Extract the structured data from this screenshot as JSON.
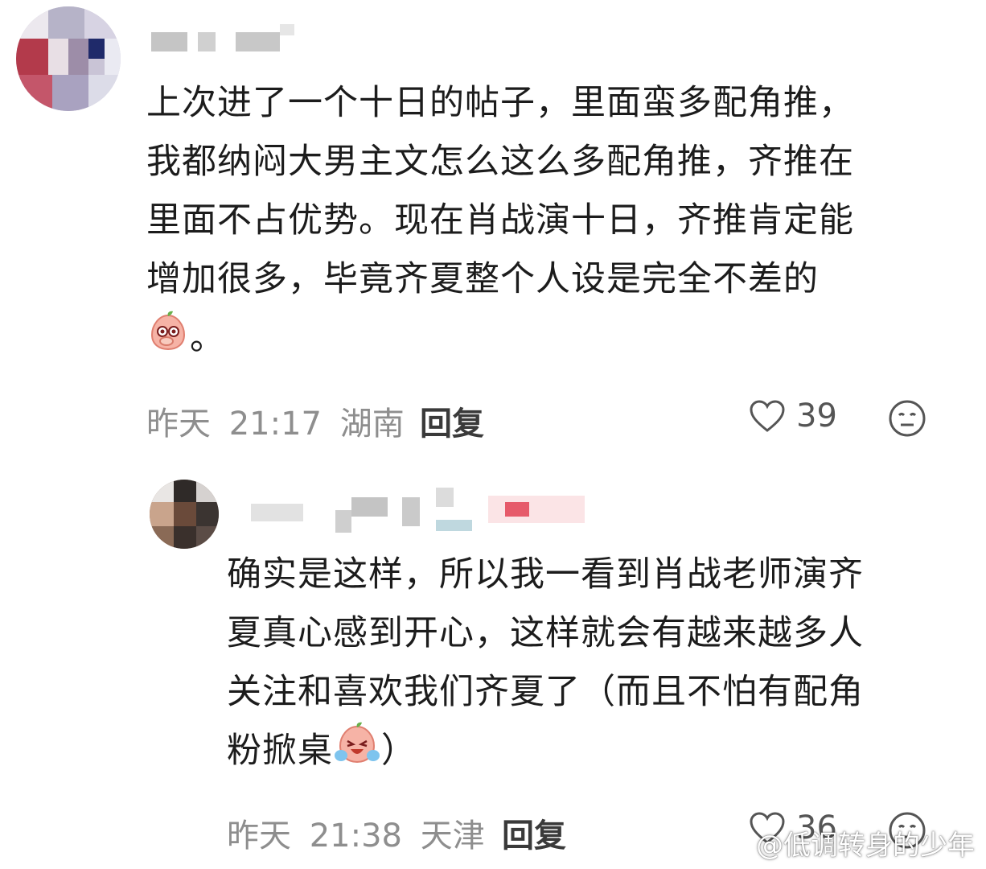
{
  "comments": [
    {
      "lines": [
        "上次进了一个十日的帖子，里面蛮多配角推，",
        "我都纳闷大男主文怎么这么多配角推，齐推在",
        "里面不占优势。现在肖战演十日，齐推肯定能",
        "增加很多，毕竟齐夏整个人设是完全不差的"
      ],
      "last_line_suffix": "。",
      "emoji_name": "peach-shy-emoji",
      "date": "昨天",
      "time": "21:17",
      "location": "湖南",
      "reply_label": "回复",
      "likes": "39",
      "heart_icon": "heart-outline-icon",
      "dislike_icon": "meh-face-icon"
    },
    {
      "lines": [
        "确实是这样，所以我一看到肖战老师演齐",
        "夏真心感到开心，这样就会有越来越多人",
        "关注和喜欢我们齐夏了（而且不怕有配角"
      ],
      "last_line_prefix": "粉掀桌",
      "last_line_suffix": "）",
      "emoji_name": "peach-crying-emoji",
      "date": "昨天",
      "time": "21:38",
      "location": "天津",
      "reply_label": "回复",
      "likes": "36",
      "heart_icon": "heart-outline-icon",
      "dislike_icon": "meh-face-icon"
    }
  ],
  "watermark": {
    "text": "@低调转身的少年",
    "icon": "weibo-logo-icon"
  }
}
